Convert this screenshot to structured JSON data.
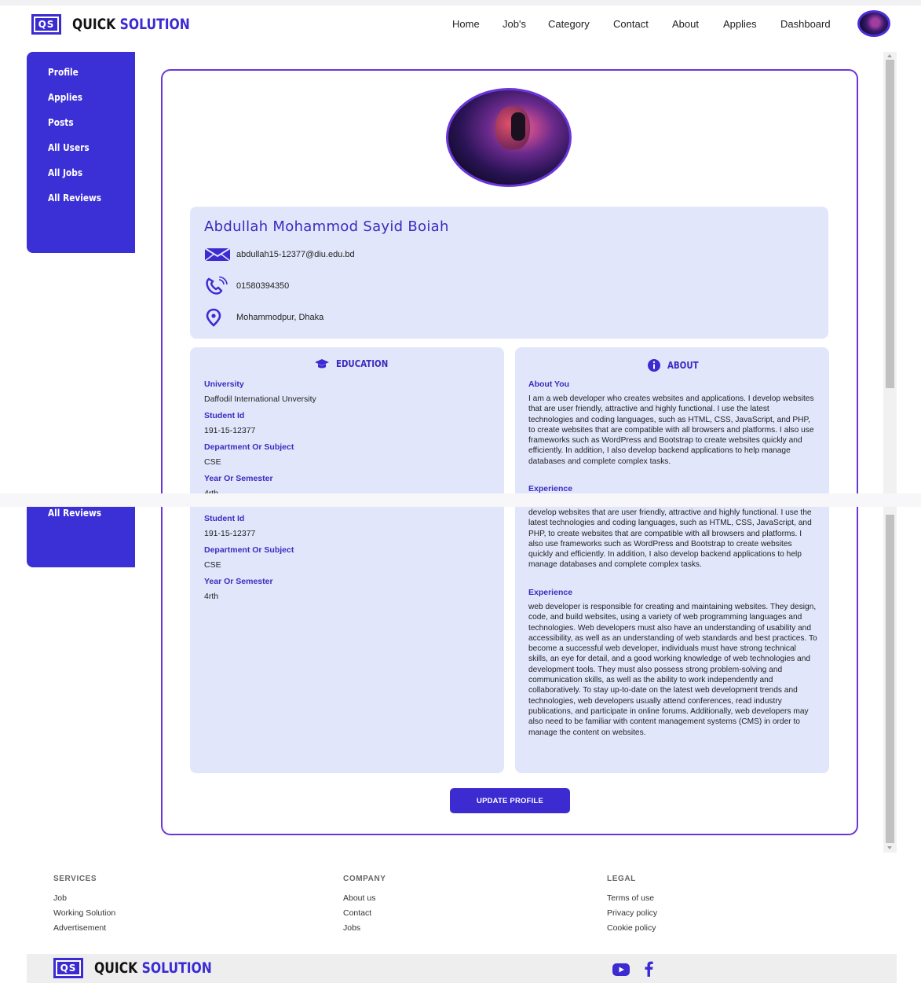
{
  "brand": {
    "logo_mark": "QS",
    "name_part1": "QUICK",
    "name_part2": "SOLUTION"
  },
  "nav": {
    "links": [
      "Home",
      "Job's",
      "Category",
      "Contact",
      "About",
      "Applies",
      "Dashboard"
    ],
    "avatar_icon": "user-avatar"
  },
  "sidebar": {
    "items": [
      "Profile",
      "Applies",
      "Posts",
      "All Users",
      "All Jobs",
      "All Reviews"
    ]
  },
  "profile": {
    "name": "Abdullah Mohammod Sayid Boiah",
    "email": "abdullah15-12377@diu.edu.bd",
    "phone": "01580394350",
    "location": "Mohammodpur, Dhaka"
  },
  "education": {
    "title": "EDUCATION",
    "university_label": "University",
    "university": "Daffodil International Unversity",
    "student_id_label": "Student Id",
    "student_id": "191-15-12377",
    "department_label": "Department Or Subject",
    "department": "CSE",
    "year_label": "Year Or Semester",
    "year": "4rth"
  },
  "about": {
    "title": "ABOUT",
    "about_you_label": "About You",
    "about_you": "I am a web developer who creates websites and applications. I develop websites that are user friendly, attractive and highly functional. I use the latest technologies and coding languages, such as HTML, CSS, JavaScript, and PHP, to create websites that are compatible with all browsers and platforms. I also use frameworks such as WordPress and Bootstrap to create websites quickly and efficiently. In addition, I also develop backend applications to help manage databases and complete complex tasks.",
    "about_you_tail": "develop websites that are user friendly, attractive and highly functional. I use the latest technologies and coding languages, such as HTML, CSS, JavaScript, and PHP, to create websites that are compatible with all browsers and platforms. I also use frameworks such as WordPress and Bootstrap to create websites quickly and efficiently. In addition, I also develop backend applications to help manage databases and complete complex tasks.",
    "experience_label": "Experience",
    "experience": "web developer is responsible for creating and maintaining websites. They design, code, and build websites, using a variety of web programming languages and technologies. Web developers must also have an understanding of usability and accessibility, as well as an understanding of web standards and best practices. To become a successful web developer, individuals must have strong technical skills, an eye for detail, and a good working knowledge of web technologies and development tools. They must also possess strong problem-solving and communication skills, as well as the ability to work independently and collaboratively. To stay up-to-date on the latest web development trends and technologies, web developers usually attend conferences, read industry publications, and participate in online forums. Additionally, web developers may also need to be familiar with content management systems (CMS) in order to manage the content on websites."
  },
  "update_button": "UPDATE PROFILE",
  "footer": {
    "services_title": "SERVICES",
    "services": [
      "Job",
      "Working Solution",
      "Advertisement"
    ],
    "company_title": "COMPANY",
    "company": [
      "About us",
      "Contact",
      "Jobs"
    ],
    "legal_title": "LEGAL",
    "legal": [
      "Terms of use",
      "Privacy policy",
      "Cookie policy"
    ],
    "social_icons": [
      "youtube-icon",
      "facebook-icon"
    ]
  },
  "colors": {
    "primary": "#3b2bd1",
    "panel_bg": "#e2e6fb",
    "card_border": "#6b36d8"
  }
}
